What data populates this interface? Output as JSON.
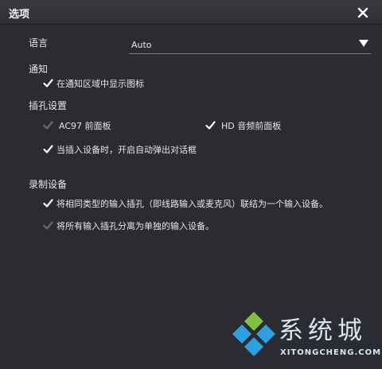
{
  "window": {
    "title": "选项"
  },
  "language": {
    "label": "语言",
    "selected": "Auto"
  },
  "notify": {
    "heading": "通知",
    "show_icon": {
      "label": "在通知区域中显示图标",
      "checked": true
    }
  },
  "jack": {
    "heading": "插孔设置",
    "ac97": {
      "label": "AC97 前面板",
      "checked": false
    },
    "hd": {
      "label": "HD 音频前面板",
      "checked": true
    },
    "auto_popup": {
      "label": "当插入设备时，开启自动弹出对话框",
      "checked": true
    }
  },
  "record": {
    "heading": "录制设备",
    "combine": {
      "label": "将相同类型的输入插孔（即线路输入或麦克风）联结为一个输入设备。",
      "checked": true
    },
    "separate": {
      "label": "将所有输入插孔分离为单独的输入设备。",
      "checked": false
    }
  },
  "watermark": {
    "name": "系统城",
    "site": "XITONGCHENG.COM"
  },
  "colors": {
    "accent": "#2f8fd8",
    "background": "#2b2c31",
    "disabled_check": "#6b6c70"
  }
}
